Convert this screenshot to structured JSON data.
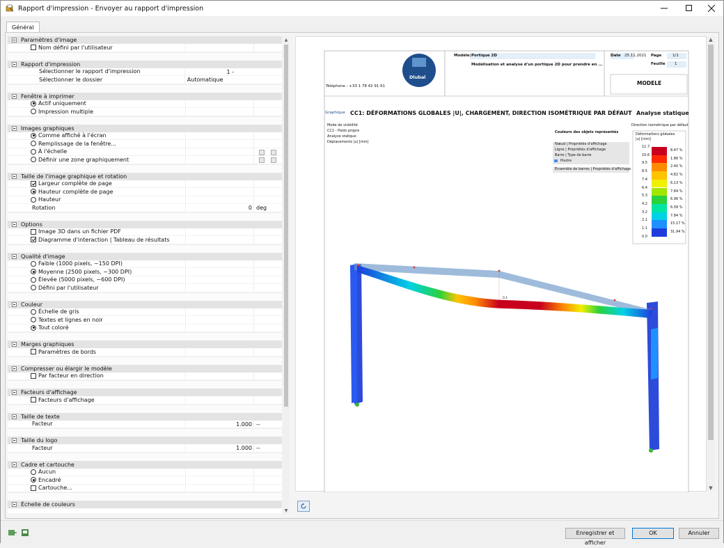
{
  "window": {
    "title": "Rapport d'impression - Envoyer au rapport d'impression"
  },
  "tabs": [
    {
      "label": "Général"
    }
  ],
  "sections": {
    "s1": {
      "title": "Paramètres d'image",
      "r1": "Nom défini par l'utilisateur"
    },
    "s2": {
      "title": "Rapport d'impression",
      "r1": "Sélectionner le rapport d'impression",
      "r1v": "1 -",
      "r2": "Sélectionner le dossier",
      "r2v": "Automatique"
    },
    "s3": {
      "title": "Fenêtre à imprimer",
      "r1": "Actif uniquement",
      "r2": "Impression multiple"
    },
    "s4": {
      "title": "Images graphiques",
      "r1": "Comme affiché à l'écran",
      "r2": "Remplissage de la fenêtre...",
      "r3": "À l'échelle",
      "r4": "Définir une zone graphiquement"
    },
    "s5": {
      "title": "Taille de l'image graphique et rotation",
      "r1": "Largeur complète de page",
      "r2": "Hauteur complète de page",
      "r3": "Hauteur",
      "r4": "Rotation",
      "r4v": "0",
      "r4u": "deg"
    },
    "s6": {
      "title": "Options",
      "r1": "Image 3D dans un fichier PDF",
      "r2": "Diagramme d'interaction | Tableau de résultats"
    },
    "s7": {
      "title": "Qualité d'image",
      "r1": "Faible (1000 pixels, ~150 DPI)",
      "r2": "Moyenne (2500 pixels, ~300 DPI)",
      "r3": "Élevée (5000 pixels, ~600 DPI)",
      "r4": "Défini par l'utilisateur"
    },
    "s8": {
      "title": "Couleur",
      "r1": "Échelle de gris",
      "r2": "Textes et lignes en noir",
      "r3": "Tout coloré"
    },
    "s9": {
      "title": "Marges graphiques",
      "r1": "Paramètres de bords"
    },
    "s10": {
      "title": "Compresser ou élargir le modèle",
      "r1": "Par facteur en direction"
    },
    "s11": {
      "title": "Facteurs d'affichage",
      "r1": "Facteurs d'affichage"
    },
    "s12": {
      "title": "Taille de texte",
      "r1": "Facteur",
      "r1v": "1.000",
      "r1u": "--"
    },
    "s13": {
      "title": "Taille du logo",
      "r1": "Facteur",
      "r1v": "1.000",
      "r1u": "--"
    },
    "s14": {
      "title": "Cadre et cartouche",
      "r1": "Aucun",
      "r2": "Encadré",
      "r3": "Cartouche..."
    },
    "s15": {
      "title": "Échelle de couleurs"
    }
  },
  "preview": {
    "phone": "Téléphone : +33 1 78 42 91 61",
    "logo": "Dlubal",
    "model_label": "Modèle:",
    "model_value": "Portique 2D",
    "model_desc": "Modélisation et analyse d'un portique 2D pour prendre en ...",
    "date_label": "Date",
    "date_value": "25.11.2021",
    "page_label": "Page",
    "page_value": "1/1",
    "sheet_label": "Feuille",
    "sheet_value": "1",
    "section_name": "MODELE",
    "graph_tag": "Graphique",
    "graph_title": "CC1: DÉFORMATIONS GLOBALES |U|, CHARGEMENT, DIRECTION ISOMÉTRIQUE PAR DÉFAUT",
    "analysis": "Analyse statique",
    "info": [
      "Mode de visibilité",
      "CC1 - Poids propre",
      "Analyse statique",
      "Déplacements |u| [mm]"
    ],
    "direction": "Direction isométrique par défaut",
    "colors_title": "Couleurs des objets représentés",
    "colors_items": [
      "Nœud | Propriétés d'affichage",
      "Ligne | Propriétés d'affichage",
      "Barre | Type de barre"
    ],
    "colors_beam": "Poutre",
    "colors_set": "Ensemble de barres | Propriétés d'affichage",
    "legend_title": "Déformations globales",
    "legend_unit": "|u| [mm]",
    "legend_values": [
      "11.7",
      "10.6",
      "9.5",
      "8.5",
      "7.4",
      "6.4",
      "5.3",
      "4.2",
      "3.2",
      "2.1",
      "1.1",
      "0.0"
    ],
    "legend_percent": [
      "8.47 %",
      "1.86 %",
      "2.40 %",
      "4.82 %",
      "6.13 %",
      "7.84 %",
      "6.96 %",
      "6.58 %",
      "7.84 %",
      "15.17 %",
      "31.94 %"
    ],
    "legend_colors": [
      "#c8001e",
      "#ff2a00",
      "#ff8c00",
      "#ffc400",
      "#f0f000",
      "#a0e600",
      "#2ad23c",
      "#00e6a0",
      "#00d2e6",
      "#1e90ff",
      "#1e3cdc",
      "#0a0aa0"
    ],
    "beam_annotations": [
      "0.1"
    ]
  },
  "footer": {
    "save": "Enregistrer et afficher",
    "ok": "OK",
    "cancel": "Annuler"
  }
}
